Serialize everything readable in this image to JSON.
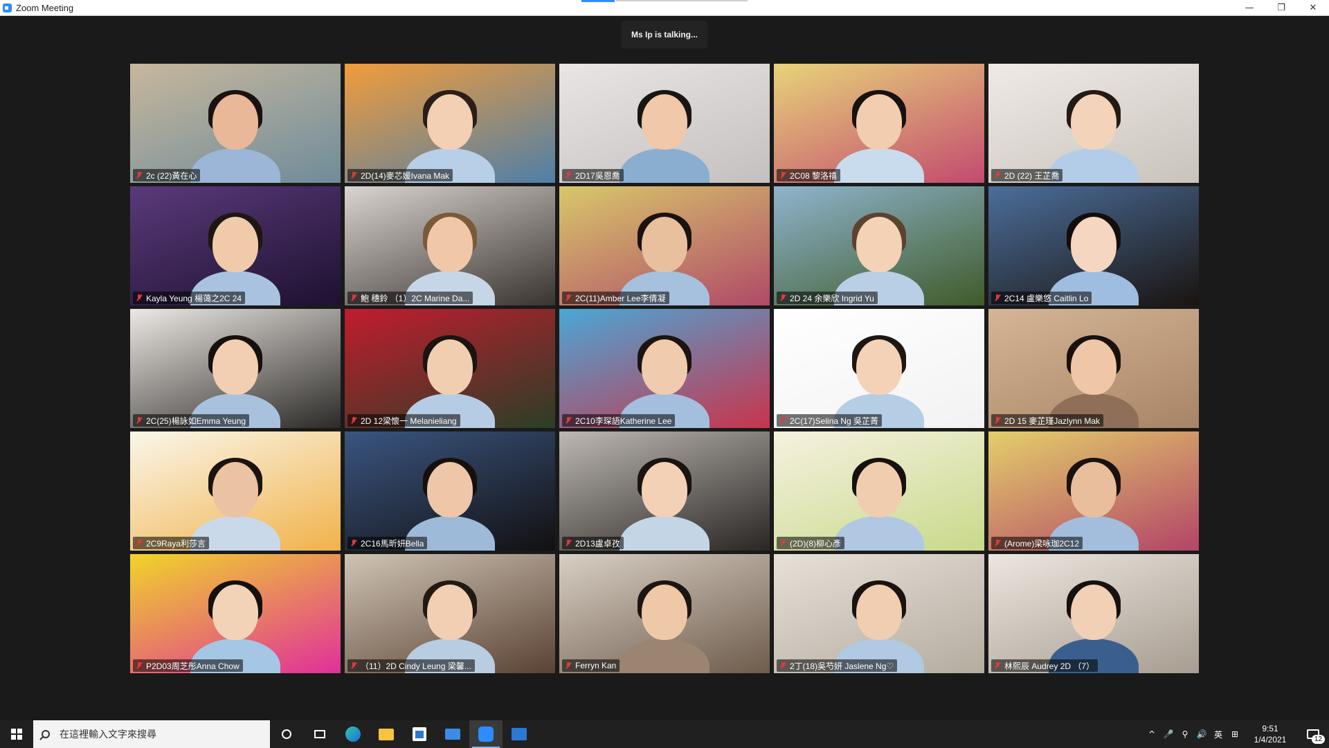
{
  "window": {
    "title": "Zoom Meeting"
  },
  "window_controls": {
    "minimize": "—",
    "restore": "❐",
    "close": "✕"
  },
  "talking_indicator": "Ms Ip is talking...",
  "participants": [
    {
      "name": "2c (22)黃在心",
      "bg": [
        "#c7b79d",
        "#6f8c9a"
      ],
      "skin": "#e8b898",
      "hair": "#1a1210",
      "shirt": "#9bb6d6"
    },
    {
      "name": "2D(14)麥芯媛Ivana Mak",
      "bg": [
        "#f29c3b",
        "#4e7fa8"
      ],
      "skin": "#f3d0b4",
      "hair": "#2a1e16",
      "shirt": "#b8cfe8"
    },
    {
      "name": "2D17吳恩喬",
      "bg": [
        "#e9e5e4",
        "#c3c0bf"
      ],
      "skin": "#f0c8aa",
      "hair": "#1a1412",
      "shirt": "#8aaecf"
    },
    {
      "name": "2C08 黎洛禧",
      "bg": [
        "#e7d37a",
        "#c34a6f"
      ],
      "skin": "#f2cdb0",
      "hair": "#17110f",
      "shirt": "#c9dced"
    },
    {
      "name": "2D (22) 王芷喬",
      "bg": [
        "#efeae6",
        "#c9c3bc"
      ],
      "skin": "#f3d4ba",
      "hair": "#231a14",
      "shirt": "#b3cde8"
    },
    {
      "name": "Kayla Yeung 楊蔼之2C 24",
      "bg": [
        "#5a3a7a",
        "#1d1130"
      ],
      "skin": "#f1caa9",
      "hair": "#1e1612",
      "shirt": "#a9c2e0"
    },
    {
      "name": "鮑 穗鈴 （1）2C Marine Da...",
      "bg": [
        "#d9d4cf",
        "#3a3431"
      ],
      "skin": "#f0c8a8",
      "hair": "#7a5a3a",
      "shirt": "#c6d6e6"
    },
    {
      "name": "2C(11)Amber Lee李倩凝",
      "bg": [
        "#d8c76b",
        "#b04a68"
      ],
      "skin": "#e9c09e",
      "hair": "#1a1310",
      "shirt": "#a6c1de"
    },
    {
      "name": "2D 24 余樂欣 Ingrid Yu",
      "bg": [
        "#8fb4cd",
        "#3f5b2a"
      ],
      "skin": "#f4d2b6",
      "hair": "#5b4330",
      "shirt": "#b9cfe6"
    },
    {
      "name": "2C14 盧樂悠 Caitlin Lo",
      "bg": [
        "#4b6e9a",
        "#1a1410"
      ],
      "skin": "#f5d6c0",
      "hair": "#120e0c",
      "shirt": "#9fbde0"
    },
    {
      "name": "2C(25)楊詠如Emma Yeung",
      "bg": [
        "#ece8e3",
        "#2c2a28"
      ],
      "skin": "#f2cfb2",
      "hair": "#15100d",
      "shirt": "#a8c2de"
    },
    {
      "name": "2D 12梁懷一 Melanieliang",
      "bg": [
        "#c21c2e",
        "#2a3f26"
      ],
      "skin": "#f2ceb1",
      "hair": "#1c1410",
      "shirt": "#b6cce4"
    },
    {
      "name": "2C10李琛語Katherine Lee",
      "bg": [
        "#4aa7d6",
        "#c9344c"
      ],
      "skin": "#f1cbad",
      "hair": "#1b1411",
      "shirt": "#a3bfdd"
    },
    {
      "name": "2C(17)Selina Ng 吳芷菁",
      "bg": [
        "#ffffff",
        "#f2f2f2"
      ],
      "skin": "#f3d2b8",
      "hair": "#1e1611",
      "shirt": "#b5cde5"
    },
    {
      "name": "2D 15 麥芷瑾Jazlynn Mak",
      "bg": [
        "#d4b595",
        "#a88466"
      ],
      "skin": "#efc6a6",
      "hair": "#18110e",
      "shirt": "#8f6f58"
    },
    {
      "name": "2C9Raya利莎言",
      "bg": [
        "#faf6ea",
        "#f0b24a"
      ],
      "skin": "#ebc2a2",
      "hair": "#1b130f",
      "shirt": "#c9d9ea"
    },
    {
      "name": "2C16馬昕妍Bella",
      "bg": [
        "#3a5580",
        "#121010"
      ],
      "skin": "#eec7a8",
      "hair": "#16100d",
      "shirt": "#9dbad9"
    },
    {
      "name": "2D13盧卓孜",
      "bg": [
        "#bdb8b2",
        "#2a2624"
      ],
      "skin": "#f3d1b6",
      "hair": "#1a130f",
      "shirt": "#c4d5e6"
    },
    {
      "name": "(2D)(8)柳心彥",
      "bg": [
        "#f6f1e0",
        "#c8d98a"
      ],
      "skin": "#f1cdb0",
      "hair": "#16110e",
      "shirt": "#b0c8e2"
    },
    {
      "name": "(Arome)梁咏珈2C12",
      "bg": [
        "#e3cf6a",
        "#b34468"
      ],
      "skin": "#e9be9c",
      "hair": "#19120f",
      "shirt": "#a2bedc"
    },
    {
      "name": "P2D03周芝彤Anna Chow",
      "bg": [
        "#f0d42a",
        "#e0309a"
      ],
      "skin": "#f3d3b8",
      "hair": "#15100d",
      "shirt": "#a6c6e6"
    },
    {
      "name": "（11）2D Cindy Leung 梁馨...",
      "bg": [
        "#cfc4b4",
        "#5a4234"
      ],
      "skin": "#f2cfb3",
      "hair": "#221912",
      "shirt": "#b9cde2"
    },
    {
      "name": "Ferryn Kan",
      "bg": [
        "#d8cfc4",
        "#6e5c4c"
      ],
      "skin": "#efc8a8",
      "hair": "#1d1511",
      "shirt": "#9b8470"
    },
    {
      "name": "2丁(18)吳芍妍 Jaslene Ng♡",
      "bg": [
        "#e6e0d8",
        "#b5aca0"
      ],
      "skin": "#f1cdb1",
      "hair": "#19120f",
      "shirt": "#b1c9e2"
    },
    {
      "name": "林熙辰 Audrey 2D （7）",
      "bg": [
        "#ece6df",
        "#a79d91"
      ],
      "skin": "#f2d0b5",
      "hair": "#17110e",
      "shirt": "#3a5f8e"
    }
  ],
  "taskbar": {
    "search_placeholder": "在這裡輸入文字來搜尋",
    "tray_chevron": "^",
    "tray_mic": "🎤",
    "tray_network": "⚲",
    "tray_volume": "🔊",
    "tray_lang": "英",
    "tray_ime": "⊞",
    "time": "9:51",
    "date": "1/4/2021",
    "notification_count": "12"
  }
}
